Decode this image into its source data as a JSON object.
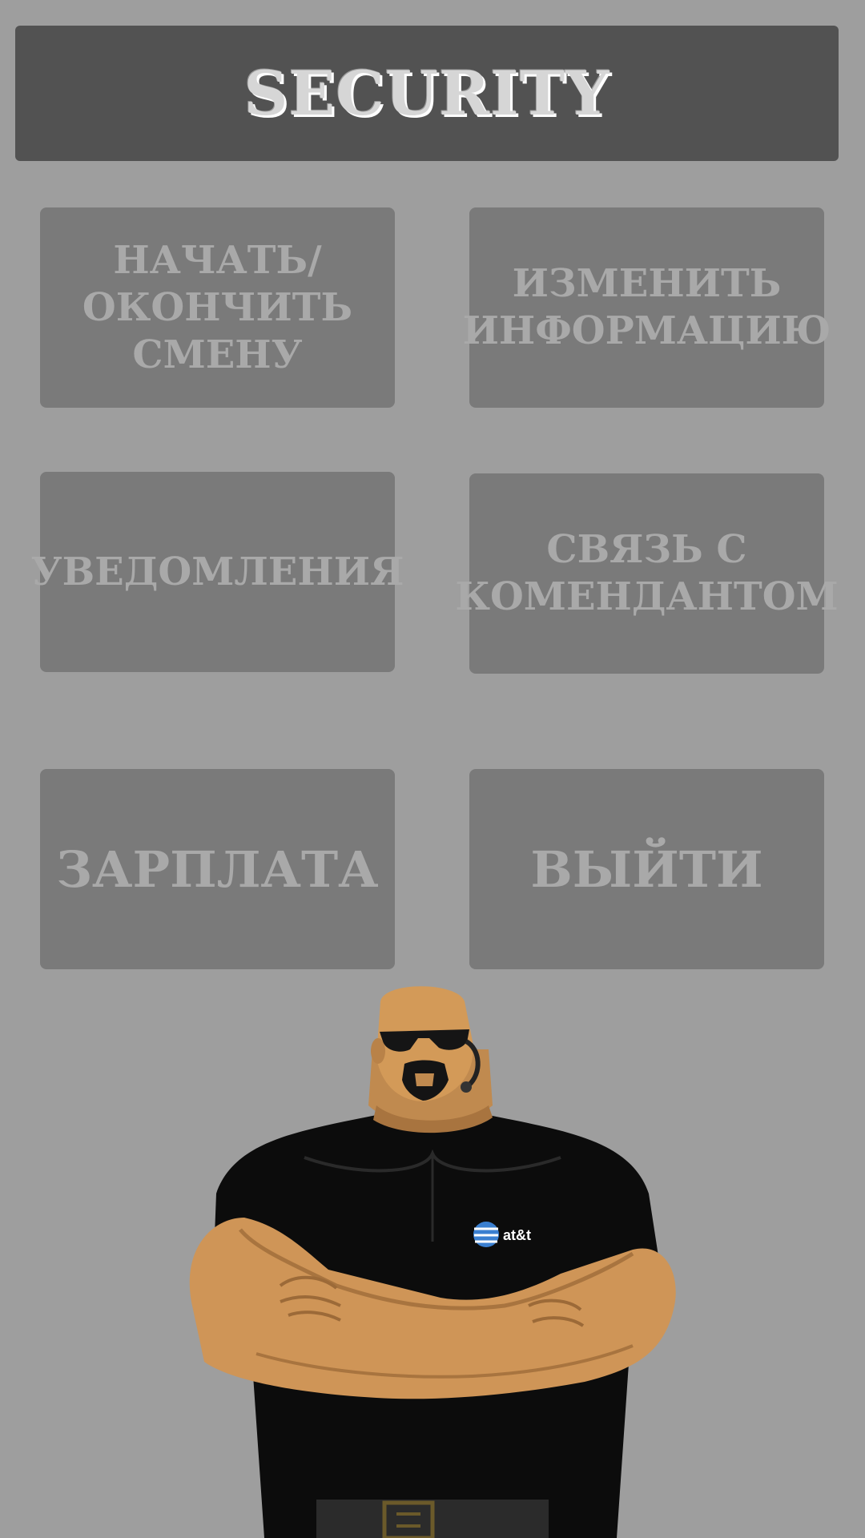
{
  "header": {
    "title": "SECURITY"
  },
  "menu": {
    "start_end_shift": "НАЧАТЬ/\nОКОНЧИТЬ\nСМЕНУ",
    "edit_info": "ИЗМЕНИТЬ\nИНФОРМАЦИЮ",
    "notifications": "УВЕДОМЛЕНИЯ",
    "contact_commandant": "СВЯЗЬ С\nКОМЕНДАНТОМ",
    "salary": "ЗАРПЛАТА",
    "exit": "ВЫЙТИ"
  },
  "illustration": {
    "shirt_logo": "at&t"
  },
  "colors": {
    "background": "#9e9e9e",
    "header_bg": "#525252",
    "tile_bg": "#7a7a7a",
    "tile_text": "#a9a9a9"
  }
}
